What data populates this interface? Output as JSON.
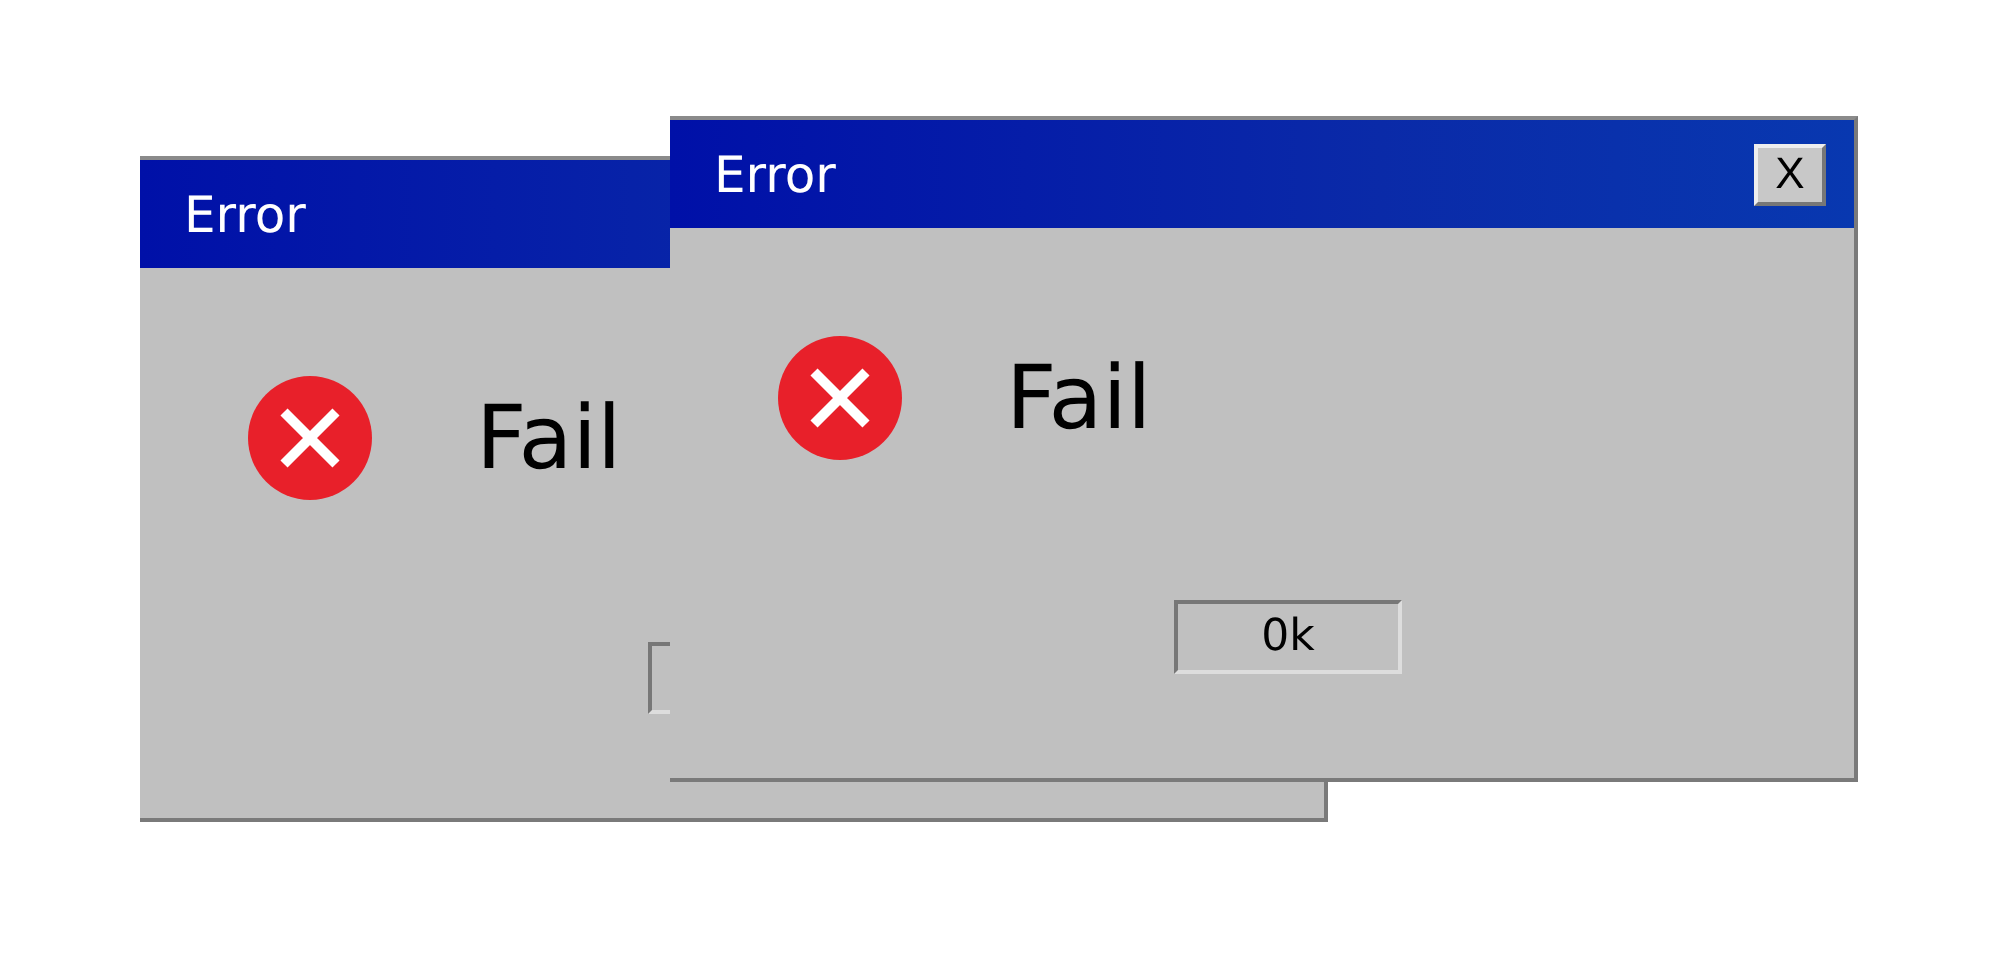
{
  "windows": [
    {
      "title": "Error",
      "message": "Fail"
    },
    {
      "title": "Error",
      "message": "Fail",
      "close_label": "X",
      "button_label": "0k"
    }
  ]
}
